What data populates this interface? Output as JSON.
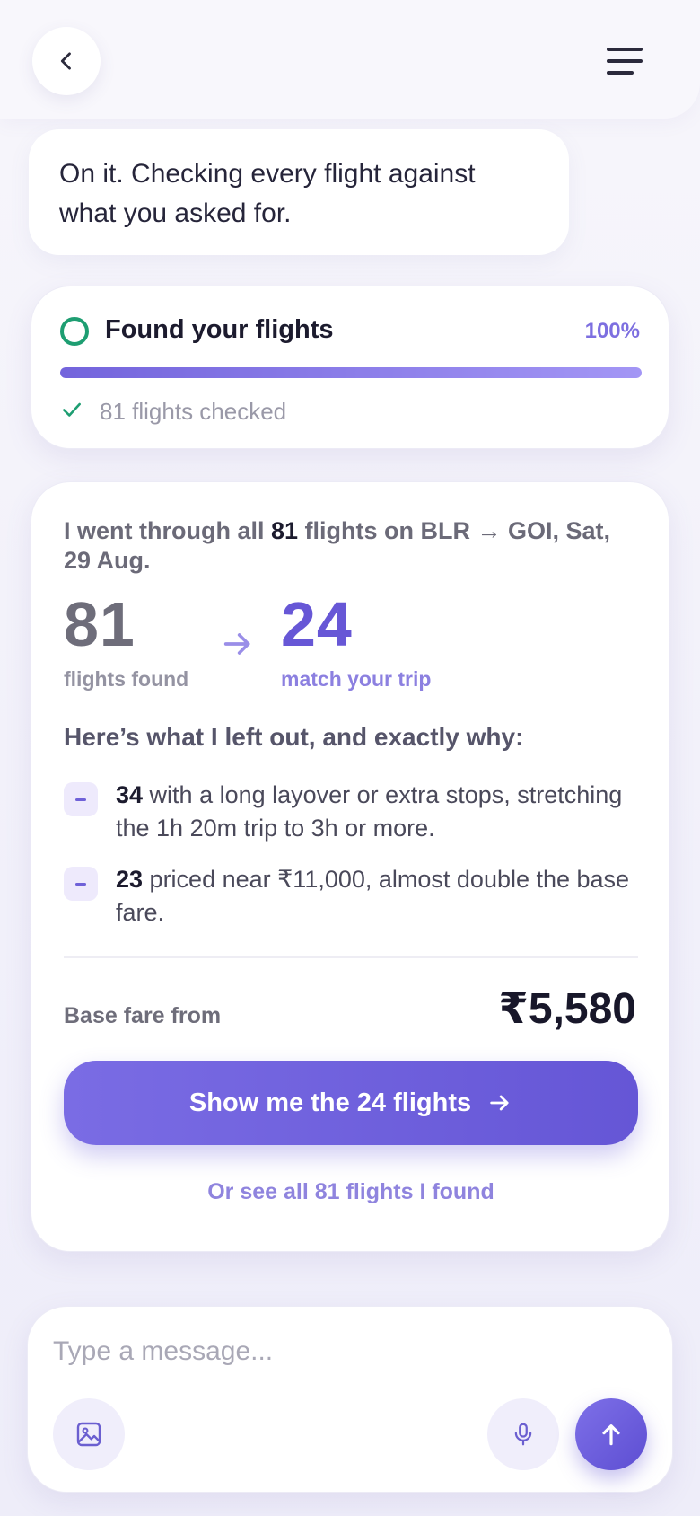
{
  "header": {
    "back_icon": "chevron-left-icon",
    "menu_icon": "hamburger-menu-icon"
  },
  "chat": {
    "assistant_message": "On it. Checking every flight against what you asked for."
  },
  "progress": {
    "title": "Found your flights",
    "percent_label": "100%",
    "percent_value": 100,
    "checked_text": "81 flights checked",
    "colors": {
      "ring": "#1e9e72",
      "accent": "#7d6fe0"
    }
  },
  "summary": {
    "intro_prefix": "I went through all ",
    "intro_count": "81",
    "intro_suffix": " flights on BLR → GOI, Sat, 29 Aug.",
    "found_count": "81",
    "found_label": "flights found",
    "match_count": "24",
    "match_label": "match your trip",
    "heading": "Here’s what I left out, and exactly why:",
    "reasons": [
      {
        "count": "34",
        "text": " with a long layover or extra stops, stretching the 1h 20m trip to 3h or more."
      },
      {
        "count": "23",
        "text": " priced near ₹11,000, almost double the base fare."
      }
    ],
    "fare_label": "Base fare from",
    "fare_value": "₹5,580",
    "primary_button": "Show me the 24 flights",
    "secondary_link": "Or see all 81 flights I found"
  },
  "composer": {
    "placeholder": "Type a message...",
    "value": "",
    "image_icon": "image-icon",
    "mic_icon": "microphone-icon",
    "send_icon": "arrow-up-icon"
  }
}
